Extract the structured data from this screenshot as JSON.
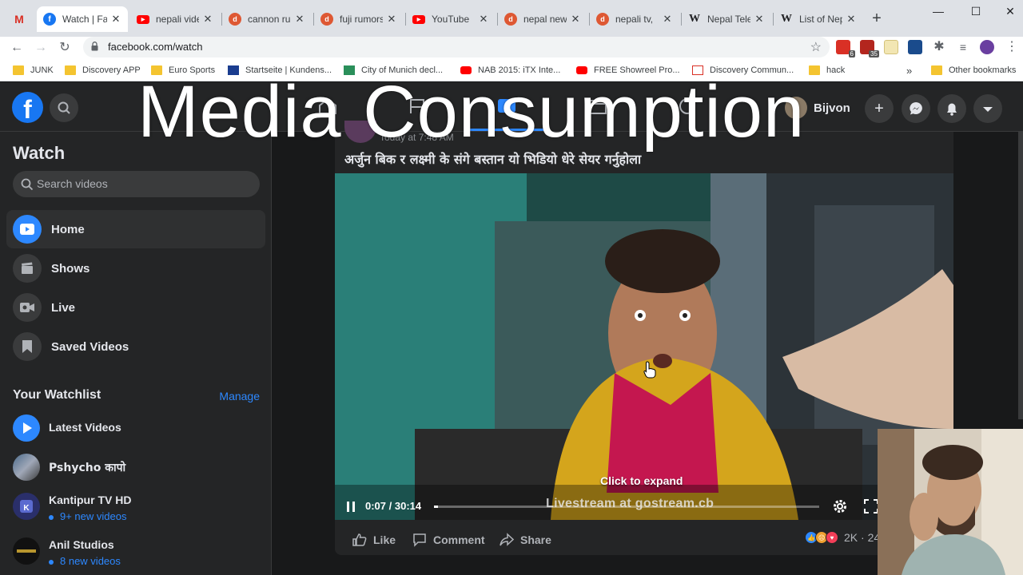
{
  "browser": {
    "tabs": [
      {
        "title": "",
        "icon": "gmail-icon"
      },
      {
        "title": "Watch | Fa",
        "icon": "facebook-icon",
        "active": true
      },
      {
        "title": "nepali vide",
        "icon": "youtube-icon"
      },
      {
        "title": "cannon ru",
        "icon": "duckduckgo-icon"
      },
      {
        "title": "fuji rumors",
        "icon": "duckduckgo-icon"
      },
      {
        "title": "YouTube",
        "icon": "youtube-icon"
      },
      {
        "title": "nepal new",
        "icon": "duckduckgo-icon"
      },
      {
        "title": "nepali tv, ",
        "icon": "duckduckgo-icon"
      },
      {
        "title": "Nepal Tele",
        "icon": "wikipedia-icon"
      },
      {
        "title": "List of Nep",
        "icon": "wikipedia-icon"
      }
    ],
    "url": "facebook.com/watch",
    "extension_badges": [
      "6",
      "35"
    ],
    "bookmarks": [
      {
        "label": "JUNK",
        "icon": "folder-icon"
      },
      {
        "label": "Discovery APP",
        "icon": "folder-icon"
      },
      {
        "label": "Euro Sports",
        "icon": "folder-icon"
      },
      {
        "label": "Startseite | Kundens...",
        "icon": "site-icon"
      },
      {
        "label": "City of Munich decl...",
        "icon": "site-icon"
      },
      {
        "label": "NAB 2015: iTX Inte...",
        "icon": "youtube-icon"
      },
      {
        "label": "FREE Showreel Pro...",
        "icon": "youtube-icon"
      },
      {
        "label": "Discovery Commun...",
        "icon": "site-icon"
      },
      {
        "label": "hack",
        "icon": "folder-icon"
      }
    ],
    "bookmarks_overflow": "»",
    "other_bookmarks": "Other bookmarks"
  },
  "facebook": {
    "logo": "f",
    "profile_name": "Bijvon",
    "sidebar": {
      "title": "Watch",
      "search_placeholder": "Search videos",
      "items": [
        {
          "label": "Home",
          "icon": "watch-home-icon",
          "active": true
        },
        {
          "label": "Shows",
          "icon": "clapperboard-icon"
        },
        {
          "label": "Live",
          "icon": "live-camera-icon"
        },
        {
          "label": "Saved Videos",
          "icon": "bookmark-icon"
        }
      ],
      "watchlist_title": "Your Watchlist",
      "manage_label": "Manage",
      "watchlist": [
        {
          "name": "Latest Videos",
          "sub": ""
        },
        {
          "name": "Pshycho कापो",
          "sub": ""
        },
        {
          "name": "Kantipur TV HD",
          "sub": "9+ new videos"
        },
        {
          "name": "Anil Studios",
          "sub": "8 new videos"
        }
      ]
    },
    "post": {
      "meta": "Today at 7:48 AM",
      "text": "अर्जुन बिक र लक्ष्मी के संगे बस्तान यो भिडियो धेरे सेयर गर्नुहोला",
      "video": {
        "elapsed": "0:07",
        "duration": "30:14",
        "time_label": "0:07 / 30:14",
        "progress": 0.004,
        "click_to_expand": "Click to expand",
        "watermark": "Livestream at gostream.cb"
      },
      "actions": {
        "like": "Like",
        "comment": "Comment",
        "share": "Share"
      },
      "reaction_count": "2K · 24"
    }
  },
  "overlay": {
    "title": "Media Consumption"
  },
  "colors": {
    "fb_blue": "#1877f2",
    "link_blue": "#2d88ff",
    "surface": "#242526",
    "background": "#18191a"
  }
}
